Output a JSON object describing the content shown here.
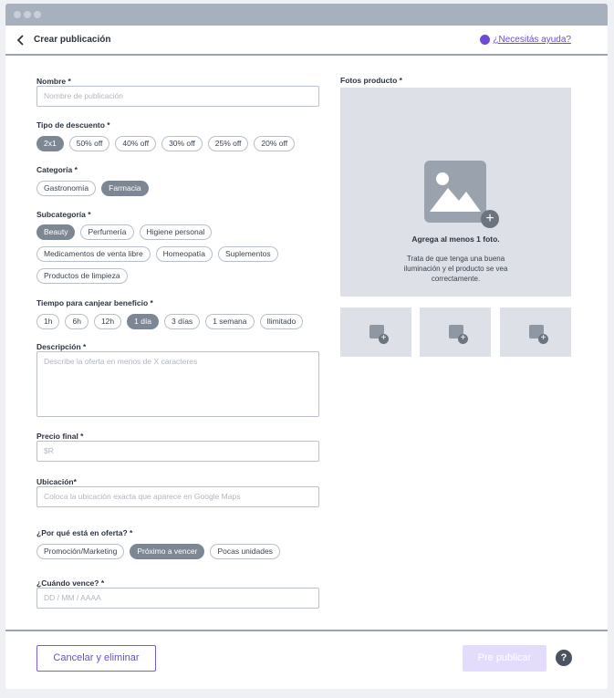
{
  "header": {
    "title": "Crear publicación",
    "help_link": "¿Necesitás ayuda?"
  },
  "form": {
    "nombre": {
      "label": "Nombre *",
      "placeholder": "Nombre de publicación"
    },
    "tipo_descuento": {
      "label": "Tipo de descuento *",
      "options": [
        "2x1",
        "50% off",
        "40% off",
        "30% off",
        "25% off",
        "20% off"
      ],
      "selected": "2x1"
    },
    "categoria": {
      "label": "Categoría *",
      "options": [
        "Gastronomía",
        "Farmacia"
      ],
      "selected": "Farmacia"
    },
    "subcategoria": {
      "label": "Subcategoría *",
      "options": [
        "Beauty",
        "Perfumería",
        "Higiene personal",
        "Medicamentos de venta libre",
        "Homeopatía",
        "Suplementos",
        "Productos de limpieza"
      ],
      "selected": "Beauty"
    },
    "tiempo": {
      "label": "Tiempo para canjear beneficio *",
      "options": [
        "1h",
        "6h",
        "12h",
        "1 día",
        "3 días",
        "1 semana",
        "Ilimitado"
      ],
      "selected": "1 día"
    },
    "descripcion": {
      "label": "Descripción *",
      "placeholder": "Describe la oferta en menos de X caracteres"
    },
    "precio": {
      "label": "Precio final *",
      "placeholder": "$R"
    },
    "ubicacion": {
      "label": "Ubicación*",
      "placeholder": "Coloca la ubicación exacta que aparece en Google Maps"
    },
    "motivo": {
      "label": "¿Por qué está en oferta? *",
      "options": [
        "Promoción/Marketing",
        "Próximo a vencer",
        "Pocas unidades"
      ],
      "selected": "Próximo a vencer"
    },
    "vence": {
      "label": "¿Cuándo vence? *",
      "placeholder": "DD / MM / AAAA"
    }
  },
  "photos": {
    "label": "Fotos producto *",
    "hint_title": "Agrega al menos 1 foto.",
    "hint_body": "Trata de que tenga una buena iluminación y el producto se vea correctamente."
  },
  "footer": {
    "cancel_label": "Cancelar y eliminar",
    "prepublish_label": "Pre publicar",
    "help_symbol": "?"
  },
  "colors": {
    "accent": "#6f4ad6",
    "chip_selected": "#7d8794",
    "prepublish_disabled": "#e3dcfb"
  }
}
